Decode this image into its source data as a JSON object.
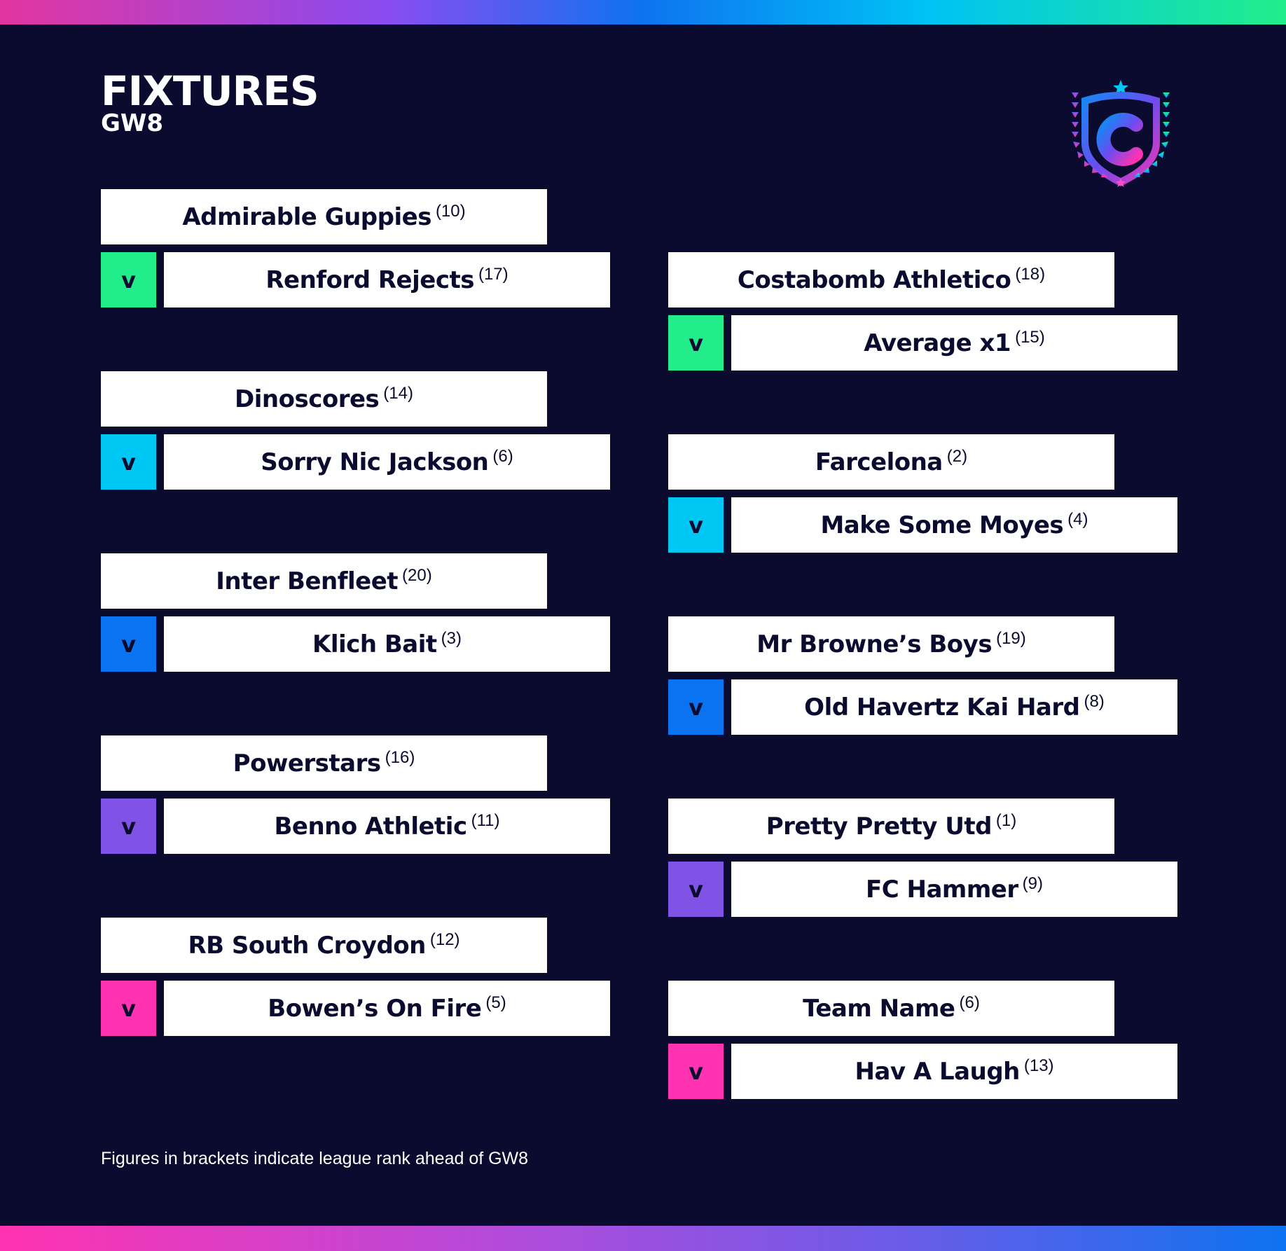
{
  "header": {
    "title": "FIXTURES",
    "gameweek": "GW8"
  },
  "versus_label": "v",
  "fixtures": [
    {
      "home": {
        "name": "Admirable Guppies",
        "rank": "(10)"
      },
      "away": {
        "name": "Renford Rejects",
        "rank": "(17)"
      },
      "accent": "#21ee8a"
    },
    {
      "home": {
        "name": "Dinoscores",
        "rank": "(14)"
      },
      "away": {
        "name": "Sorry Nic Jackson",
        "rank": "(6)"
      },
      "accent": "#00c8f5"
    },
    {
      "home": {
        "name": "Inter Benfleet",
        "rank": "(20)"
      },
      "away": {
        "name": "Klich Bait",
        "rank": "(3)"
      },
      "accent": "#0a73f0"
    },
    {
      "home": {
        "name": "Powerstars",
        "rank": "(16)"
      },
      "away": {
        "name": "Benno Athletic",
        "rank": "(11)"
      },
      "accent": "#8052e6"
    },
    {
      "home": {
        "name": "RB South Croydon",
        "rank": "(12)"
      },
      "away": {
        "name": "Bowen’s On Fire",
        "rank": "(5)"
      },
      "accent": "#ff33b1"
    },
    {
      "home": {
        "name": "Costabomb Athletico",
        "rank": "(18)"
      },
      "away": {
        "name": "Average x1",
        "rank": "(15)"
      },
      "accent": "#21ee8a"
    },
    {
      "home": {
        "name": "Farcelona",
        "rank": "(2)"
      },
      "away": {
        "name": "Make Some Moyes",
        "rank": "(4)"
      },
      "accent": "#00c8f5"
    },
    {
      "home": {
        "name": "Mr Browne’s Boys",
        "rank": "(19)"
      },
      "away": {
        "name": "Old Havertz Kai Hard",
        "rank": "(8)"
      },
      "accent": "#0a73f0"
    },
    {
      "home": {
        "name": "Pretty Pretty Utd",
        "rank": "(1)"
      },
      "away": {
        "name": "FC Hammer",
        "rank": "(9)"
      },
      "accent": "#8052e6"
    },
    {
      "home": {
        "name": "Team Name",
        "rank": "(6)"
      },
      "away": {
        "name": "Hav A Laugh",
        "rank": "(13)"
      },
      "accent": "#ff33b1"
    }
  ],
  "footnote": "Figures in brackets indicate league rank ahead of GW8",
  "colors": {
    "background": "#0b0b2f",
    "card": "#ffffff",
    "text_dark": "#0b0b2f"
  },
  "logo": {
    "icon": "league-crest-icon",
    "letter": "C"
  }
}
